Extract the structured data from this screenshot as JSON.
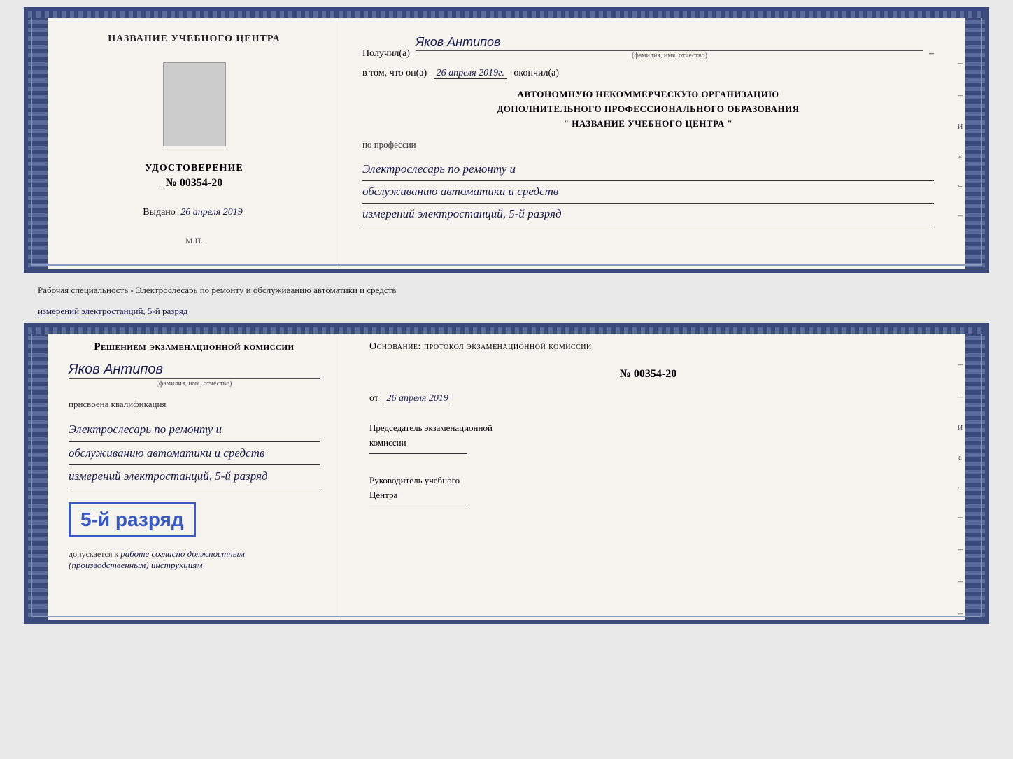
{
  "top_doc": {
    "left_panel": {
      "center_title": "НАЗВАНИЕ УЧЕБНОГО ЦЕНТРА",
      "cert_title": "УДОСТОВЕРЕНИЕ",
      "cert_number": "№ 00354-20",
      "issued_label": "Выдано",
      "issued_date": "26 апреля 2019",
      "stamp_label": "М.П."
    },
    "right_panel": {
      "received_label": "Получил(а)",
      "recipient_name": "Яков Антипов",
      "fio_label": "(фамилия, имя, отчество)",
      "date_prefix": "в том, что он(а)",
      "date_value": "26 апреля 2019г.",
      "date_suffix": "окончил(а)",
      "org_line1": "АВТОНОМНУЮ НЕКОММЕРЧЕСКУЮ ОРГАНИЗАЦИЮ",
      "org_line2": "ДОПОЛНИТЕЛЬНОГО ПРОФЕССИОНАЛЬНОГО ОБРАЗОВАНИЯ",
      "org_line3": "\"   НАЗВАНИЕ УЧЕБНОГО ЦЕНТРА   \"",
      "profession_label": "по профессии",
      "profession_line1": "Электрослесарь по ремонту и",
      "profession_line2": "обслуживанию автоматики и средств",
      "profession_line3": "измерений электростанций, 5-й разряд"
    }
  },
  "specialty_label": "Рабочая специальность - Электрослесарь по ремонту и обслуживанию автоматики и средств",
  "specialty_label2": "измерений электростанций, 5-й разряд",
  "bottom_doc": {
    "left_panel": {
      "commission_title": "Решением экзаменационной комиссии",
      "person_name": "Яков Антипов",
      "fio_label": "(фамилия, имя, отчество)",
      "qualification_label": "присвоена квалификация",
      "qual_line1": "Электрослесарь по ремонту и",
      "qual_line2": "обслуживанию автоматики и средств",
      "qual_line3": "измерений электростанций, 5-й разряд",
      "grade_text": "5-й разряд",
      "allowed_label": "допускается к",
      "allowed_text": "работе согласно должностным",
      "allowed_text2": "(производственным) инструкциям"
    },
    "right_panel": {
      "basis_label": "Основание: протокол экзаменационной комиссии",
      "protocol_number": "№ 00354-20",
      "date_prefix": "от",
      "date_value": "26 апреля 2019",
      "chairman_label": "Председатель экзаменационной",
      "chairman_label2": "комиссии",
      "director_label": "Руководитель учебного",
      "director_label2": "Центра"
    },
    "right_chars": {
      "char1": "И",
      "char2": "а",
      "char3": "←"
    }
  }
}
